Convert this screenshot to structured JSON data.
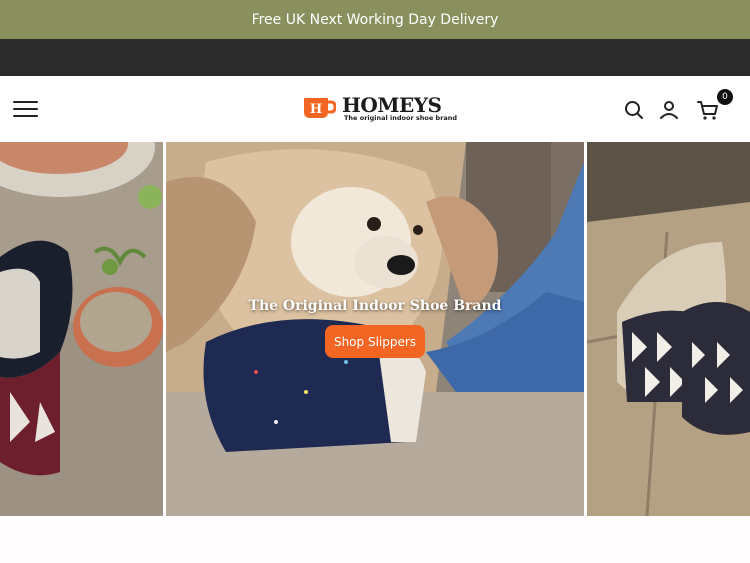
{
  "announcement": {
    "text": "Free UK Next Working Day Delivery"
  },
  "header": {
    "logo_word": "HOMEYS",
    "logo_tagline": "The original indoor shoe brand",
    "cart_count": "0"
  },
  "hero": {
    "headline": "The Original Indoor Shoe Brand",
    "cta_label": "Shop Slippers"
  },
  "colors": {
    "announcement_bg": "#8a8f5e",
    "dark_bar": "#2b2b2b",
    "accent": "#f26522"
  },
  "icons": [
    "menu-icon",
    "search-icon",
    "account-icon",
    "cart-icon"
  ]
}
